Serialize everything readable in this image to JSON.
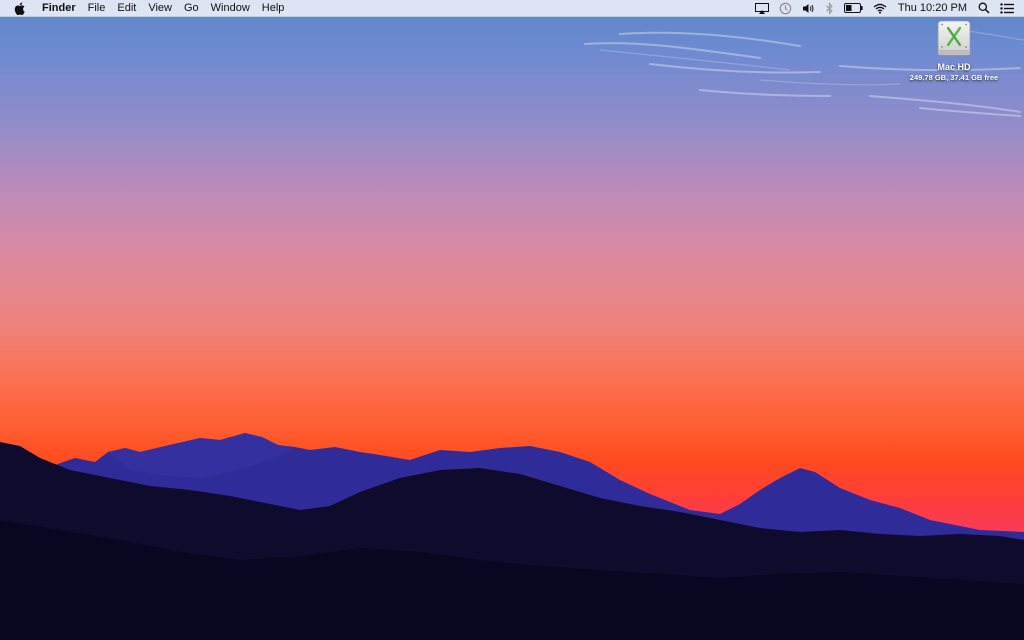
{
  "menubar": {
    "apple_icon": "apple-icon",
    "app_name": "Finder",
    "menus": [
      "File",
      "Edit",
      "View",
      "Go",
      "Window",
      "Help"
    ],
    "status_icons": [
      "airplay-icon",
      "time-machine-icon",
      "volume-icon",
      "bluetooth-icon",
      "battery-icon",
      "wifi-icon"
    ],
    "clock": "Thu 10:20 PM",
    "spotlight_icon": "spotlight-search-icon",
    "notification_icon": "notification-center-icon"
  },
  "desktop": {
    "disk": {
      "name": "Mac HD",
      "info": "249.78 GB, 37.41 GB free",
      "icon": "hard-drive-icon"
    }
  },
  "colors": {
    "menubar_bg": "#e8ecf6",
    "sky_top": "#5a86c9",
    "horizon": "#ff4a1f",
    "sky_bottom_right": "#d83a8a",
    "mountains_far": "#2e2a9a",
    "mountains_near": "#0d0a2a"
  }
}
